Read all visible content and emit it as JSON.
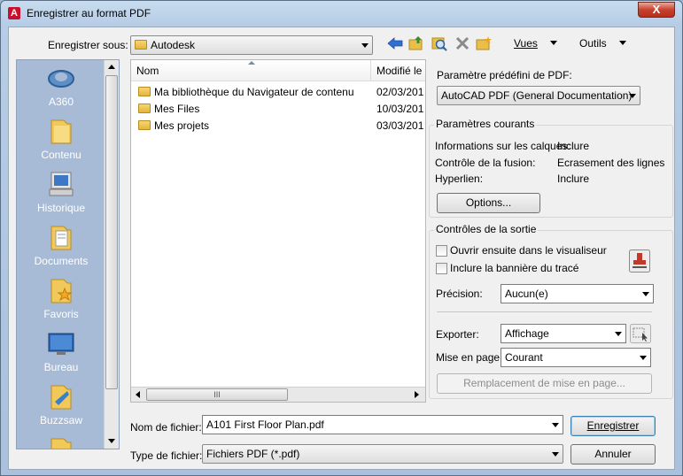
{
  "window": {
    "title": "Enregistrer au format PDF",
    "close_glyph": "X"
  },
  "toolbar": {
    "save_in_label": "Enregistrer sous:",
    "save_in_value": "Autodesk",
    "views_label": "Vues",
    "tools_label": "Outils"
  },
  "places": [
    {
      "label": "A360",
      "icon": "a360-icon"
    },
    {
      "label": "Contenu",
      "icon": "folder-icon"
    },
    {
      "label": "Historique",
      "icon": "history-icon"
    },
    {
      "label": "Documents",
      "icon": "documents-icon"
    },
    {
      "label": "Favoris",
      "icon": "favorites-icon"
    },
    {
      "label": "Bureau",
      "icon": "desktop-icon"
    },
    {
      "label": "Buzzsaw",
      "icon": "buzzsaw-icon"
    }
  ],
  "file_list": {
    "columns": {
      "name": "Nom",
      "modified": "Modifié le"
    },
    "rows": [
      {
        "name": "Ma bibliothèque du Navigateur de contenu",
        "date": "02/03/201"
      },
      {
        "name": "Mes Files",
        "date": "10/03/201"
      },
      {
        "name": "Mes projets",
        "date": "03/03/201"
      }
    ],
    "hscroll_grip": "III"
  },
  "pdf_preset": {
    "label": "Paramètre prédéfini de PDF:",
    "value": "AutoCAD PDF (General Documentation)"
  },
  "current_settings": {
    "title": "Paramètres courants",
    "rows": [
      {
        "label": "Informations sur les calques:",
        "value": "Inclure"
      },
      {
        "label": "Contrôle de la fusion:",
        "value": "Ecrasement des lignes"
      },
      {
        "label": "Hyperlien:",
        "value": "Inclure"
      }
    ],
    "options_button": "Options..."
  },
  "output": {
    "title": "Contrôles de la sortie",
    "open_viewer": "Ouvrir ensuite dans le visualiseur",
    "include_banner": "Inclure la bannière du tracé",
    "precision_label": "Précision:",
    "precision_value": "Aucun(e)",
    "export_label": "Exporter:",
    "export_value": "Affichage",
    "page_setup_label": "Mise en page:",
    "page_setup_value": "Courant",
    "page_setup_override": "Remplacement de mise en page..."
  },
  "bottom": {
    "filename_label": "Nom de fichier:",
    "filename_value": "A101 First Floor Plan.pdf",
    "filetype_label": "Type de fichier:",
    "filetype_value": "Fichiers PDF (*.pdf)",
    "save_button": "Enregistrer",
    "cancel_button": "Annuler"
  },
  "colors": {
    "accent": "#3c7fb1",
    "places_bg": "#a7bbd6",
    "close": "#c7412e"
  }
}
